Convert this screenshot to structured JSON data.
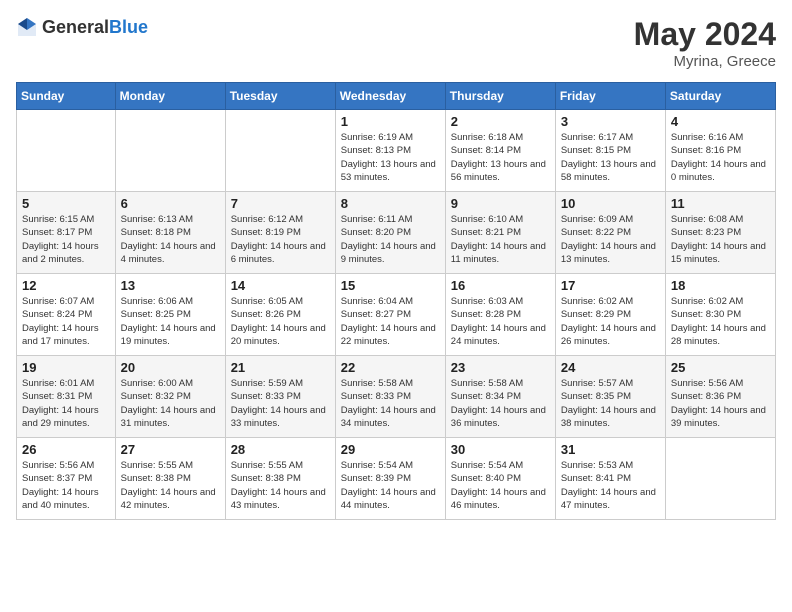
{
  "header": {
    "logo_general": "General",
    "logo_blue": "Blue",
    "month_year": "May 2024",
    "location": "Myrina, Greece"
  },
  "days_of_week": [
    "Sunday",
    "Monday",
    "Tuesday",
    "Wednesday",
    "Thursday",
    "Friday",
    "Saturday"
  ],
  "weeks": [
    [
      {
        "day": "",
        "sunrise": "",
        "sunset": "",
        "daylight": ""
      },
      {
        "day": "",
        "sunrise": "",
        "sunset": "",
        "daylight": ""
      },
      {
        "day": "",
        "sunrise": "",
        "sunset": "",
        "daylight": ""
      },
      {
        "day": "1",
        "sunrise": "Sunrise: 6:19 AM",
        "sunset": "Sunset: 8:13 PM",
        "daylight": "Daylight: 13 hours and 53 minutes."
      },
      {
        "day": "2",
        "sunrise": "Sunrise: 6:18 AM",
        "sunset": "Sunset: 8:14 PM",
        "daylight": "Daylight: 13 hours and 56 minutes."
      },
      {
        "day": "3",
        "sunrise": "Sunrise: 6:17 AM",
        "sunset": "Sunset: 8:15 PM",
        "daylight": "Daylight: 13 hours and 58 minutes."
      },
      {
        "day": "4",
        "sunrise": "Sunrise: 6:16 AM",
        "sunset": "Sunset: 8:16 PM",
        "daylight": "Daylight: 14 hours and 0 minutes."
      }
    ],
    [
      {
        "day": "5",
        "sunrise": "Sunrise: 6:15 AM",
        "sunset": "Sunset: 8:17 PM",
        "daylight": "Daylight: 14 hours and 2 minutes."
      },
      {
        "day": "6",
        "sunrise": "Sunrise: 6:13 AM",
        "sunset": "Sunset: 8:18 PM",
        "daylight": "Daylight: 14 hours and 4 minutes."
      },
      {
        "day": "7",
        "sunrise": "Sunrise: 6:12 AM",
        "sunset": "Sunset: 8:19 PM",
        "daylight": "Daylight: 14 hours and 6 minutes."
      },
      {
        "day": "8",
        "sunrise": "Sunrise: 6:11 AM",
        "sunset": "Sunset: 8:20 PM",
        "daylight": "Daylight: 14 hours and 9 minutes."
      },
      {
        "day": "9",
        "sunrise": "Sunrise: 6:10 AM",
        "sunset": "Sunset: 8:21 PM",
        "daylight": "Daylight: 14 hours and 11 minutes."
      },
      {
        "day": "10",
        "sunrise": "Sunrise: 6:09 AM",
        "sunset": "Sunset: 8:22 PM",
        "daylight": "Daylight: 14 hours and 13 minutes."
      },
      {
        "day": "11",
        "sunrise": "Sunrise: 6:08 AM",
        "sunset": "Sunset: 8:23 PM",
        "daylight": "Daylight: 14 hours and 15 minutes."
      }
    ],
    [
      {
        "day": "12",
        "sunrise": "Sunrise: 6:07 AM",
        "sunset": "Sunset: 8:24 PM",
        "daylight": "Daylight: 14 hours and 17 minutes."
      },
      {
        "day": "13",
        "sunrise": "Sunrise: 6:06 AM",
        "sunset": "Sunset: 8:25 PM",
        "daylight": "Daylight: 14 hours and 19 minutes."
      },
      {
        "day": "14",
        "sunrise": "Sunrise: 6:05 AM",
        "sunset": "Sunset: 8:26 PM",
        "daylight": "Daylight: 14 hours and 20 minutes."
      },
      {
        "day": "15",
        "sunrise": "Sunrise: 6:04 AM",
        "sunset": "Sunset: 8:27 PM",
        "daylight": "Daylight: 14 hours and 22 minutes."
      },
      {
        "day": "16",
        "sunrise": "Sunrise: 6:03 AM",
        "sunset": "Sunset: 8:28 PM",
        "daylight": "Daylight: 14 hours and 24 minutes."
      },
      {
        "day": "17",
        "sunrise": "Sunrise: 6:02 AM",
        "sunset": "Sunset: 8:29 PM",
        "daylight": "Daylight: 14 hours and 26 minutes."
      },
      {
        "day": "18",
        "sunrise": "Sunrise: 6:02 AM",
        "sunset": "Sunset: 8:30 PM",
        "daylight": "Daylight: 14 hours and 28 minutes."
      }
    ],
    [
      {
        "day": "19",
        "sunrise": "Sunrise: 6:01 AM",
        "sunset": "Sunset: 8:31 PM",
        "daylight": "Daylight: 14 hours and 29 minutes."
      },
      {
        "day": "20",
        "sunrise": "Sunrise: 6:00 AM",
        "sunset": "Sunset: 8:32 PM",
        "daylight": "Daylight: 14 hours and 31 minutes."
      },
      {
        "day": "21",
        "sunrise": "Sunrise: 5:59 AM",
        "sunset": "Sunset: 8:33 PM",
        "daylight": "Daylight: 14 hours and 33 minutes."
      },
      {
        "day": "22",
        "sunrise": "Sunrise: 5:58 AM",
        "sunset": "Sunset: 8:33 PM",
        "daylight": "Daylight: 14 hours and 34 minutes."
      },
      {
        "day": "23",
        "sunrise": "Sunrise: 5:58 AM",
        "sunset": "Sunset: 8:34 PM",
        "daylight": "Daylight: 14 hours and 36 minutes."
      },
      {
        "day": "24",
        "sunrise": "Sunrise: 5:57 AM",
        "sunset": "Sunset: 8:35 PM",
        "daylight": "Daylight: 14 hours and 38 minutes."
      },
      {
        "day": "25",
        "sunrise": "Sunrise: 5:56 AM",
        "sunset": "Sunset: 8:36 PM",
        "daylight": "Daylight: 14 hours and 39 minutes."
      }
    ],
    [
      {
        "day": "26",
        "sunrise": "Sunrise: 5:56 AM",
        "sunset": "Sunset: 8:37 PM",
        "daylight": "Daylight: 14 hours and 40 minutes."
      },
      {
        "day": "27",
        "sunrise": "Sunrise: 5:55 AM",
        "sunset": "Sunset: 8:38 PM",
        "daylight": "Daylight: 14 hours and 42 minutes."
      },
      {
        "day": "28",
        "sunrise": "Sunrise: 5:55 AM",
        "sunset": "Sunset: 8:38 PM",
        "daylight": "Daylight: 14 hours and 43 minutes."
      },
      {
        "day": "29",
        "sunrise": "Sunrise: 5:54 AM",
        "sunset": "Sunset: 8:39 PM",
        "daylight": "Daylight: 14 hours and 44 minutes."
      },
      {
        "day": "30",
        "sunrise": "Sunrise: 5:54 AM",
        "sunset": "Sunset: 8:40 PM",
        "daylight": "Daylight: 14 hours and 46 minutes."
      },
      {
        "day": "31",
        "sunrise": "Sunrise: 5:53 AM",
        "sunset": "Sunset: 8:41 PM",
        "daylight": "Daylight: 14 hours and 47 minutes."
      },
      {
        "day": "",
        "sunrise": "",
        "sunset": "",
        "daylight": ""
      }
    ]
  ]
}
